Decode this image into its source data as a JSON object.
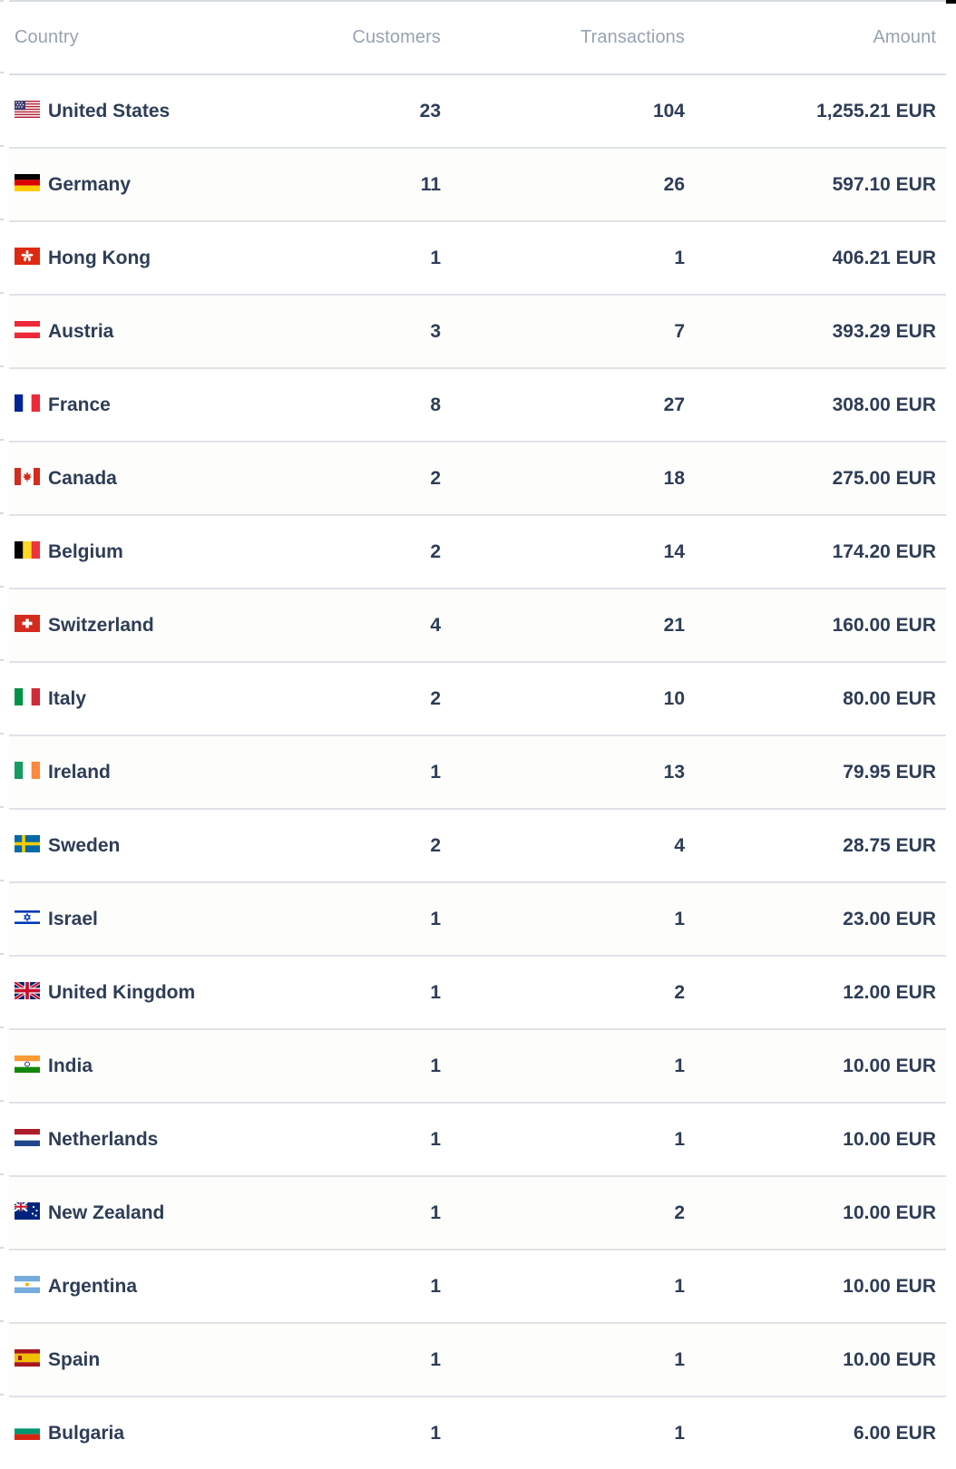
{
  "table": {
    "columns": [
      {
        "key": "country",
        "label": "Country",
        "align": "left"
      },
      {
        "key": "customers",
        "label": "Customers",
        "align": "right"
      },
      {
        "key": "transactions",
        "label": "Transactions",
        "align": "right"
      },
      {
        "key": "amount",
        "label": "Amount",
        "align": "right"
      }
    ],
    "rows": [
      {
        "flag_icon": "flag-us-icon",
        "flag_code": "US",
        "country": "United States",
        "customers": "23",
        "transactions": "104",
        "amount": "1,255.21 EUR"
      },
      {
        "flag_icon": "flag-de-icon",
        "flag_code": "DE",
        "country": "Germany",
        "customers": "11",
        "transactions": "26",
        "amount": "597.10 EUR"
      },
      {
        "flag_icon": "flag-hk-icon",
        "flag_code": "HK",
        "country": "Hong Kong",
        "customers": "1",
        "transactions": "1",
        "amount": "406.21 EUR"
      },
      {
        "flag_icon": "flag-at-icon",
        "flag_code": "AT",
        "country": "Austria",
        "customers": "3",
        "transactions": "7",
        "amount": "393.29 EUR"
      },
      {
        "flag_icon": "flag-fr-icon",
        "flag_code": "FR",
        "country": "France",
        "customers": "8",
        "transactions": "27",
        "amount": "308.00 EUR"
      },
      {
        "flag_icon": "flag-ca-icon",
        "flag_code": "CA",
        "country": "Canada",
        "customers": "2",
        "transactions": "18",
        "amount": "275.00 EUR"
      },
      {
        "flag_icon": "flag-be-icon",
        "flag_code": "BE",
        "country": "Belgium",
        "customers": "2",
        "transactions": "14",
        "amount": "174.20 EUR"
      },
      {
        "flag_icon": "flag-ch-icon",
        "flag_code": "CH",
        "country": "Switzerland",
        "customers": "4",
        "transactions": "21",
        "amount": "160.00 EUR"
      },
      {
        "flag_icon": "flag-it-icon",
        "flag_code": "IT",
        "country": "Italy",
        "customers": "2",
        "transactions": "10",
        "amount": "80.00 EUR"
      },
      {
        "flag_icon": "flag-ie-icon",
        "flag_code": "IE",
        "country": "Ireland",
        "customers": "1",
        "transactions": "13",
        "amount": "79.95 EUR"
      },
      {
        "flag_icon": "flag-se-icon",
        "flag_code": "SE",
        "country": "Sweden",
        "customers": "2",
        "transactions": "4",
        "amount": "28.75 EUR"
      },
      {
        "flag_icon": "flag-il-icon",
        "flag_code": "IL",
        "country": "Israel",
        "customers": "1",
        "transactions": "1",
        "amount": "23.00 EUR"
      },
      {
        "flag_icon": "flag-gb-icon",
        "flag_code": "GB",
        "country": "United Kingdom",
        "customers": "1",
        "transactions": "2",
        "amount": "12.00 EUR"
      },
      {
        "flag_icon": "flag-in-icon",
        "flag_code": "IN",
        "country": "India",
        "customers": "1",
        "transactions": "1",
        "amount": "10.00 EUR"
      },
      {
        "flag_icon": "flag-nl-icon",
        "flag_code": "NL",
        "country": "Netherlands",
        "customers": "1",
        "transactions": "1",
        "amount": "10.00 EUR"
      },
      {
        "flag_icon": "flag-nz-icon",
        "flag_code": "NZ",
        "country": "New Zealand",
        "customers": "1",
        "transactions": "2",
        "amount": "10.00 EUR"
      },
      {
        "flag_icon": "flag-ar-icon",
        "flag_code": "AR",
        "country": "Argentina",
        "customers": "1",
        "transactions": "1",
        "amount": "10.00 EUR"
      },
      {
        "flag_icon": "flag-es-icon",
        "flag_code": "ES",
        "country": "Spain",
        "customers": "1",
        "transactions": "1",
        "amount": "10.00 EUR"
      },
      {
        "flag_icon": "flag-bg-icon",
        "flag_code": "BG",
        "country": "Bulgaria",
        "customers": "1",
        "transactions": "1",
        "amount": "6.00 EUR"
      }
    ]
  },
  "colors": {
    "header_text": "#98a2b3",
    "value_text": "#2e3d56",
    "divider": "#dfe3e8",
    "header_divider": "#d8dde3",
    "row_stripe": "#fdfdfb",
    "background": "#ffffff",
    "top_bar": "#000000"
  }
}
